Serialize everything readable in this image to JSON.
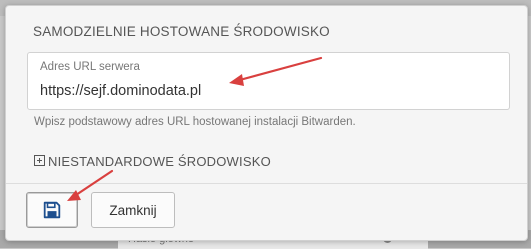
{
  "modal": {
    "section_title": "SAMODZIELNIE HOSTOWANE ŚRODOWISKO",
    "server_url_field": {
      "label": "Adres URL serwera",
      "value": "https://sejf.dominodata.pl"
    },
    "hint": "Wpisz podstawowy adres URL hostowanej instalacji Bitwarden.",
    "custom_environment_label": "NIESTANDARDOWE ŚRODOWISKO",
    "buttons": {
      "save_icon": "floppy-disk-icon",
      "close_label": "Zamknij"
    }
  },
  "background": {
    "master_password_label": "Hasło główne"
  },
  "colors": {
    "annotation_arrow": "#d9403f",
    "save_icon": "#1d4f8f"
  }
}
